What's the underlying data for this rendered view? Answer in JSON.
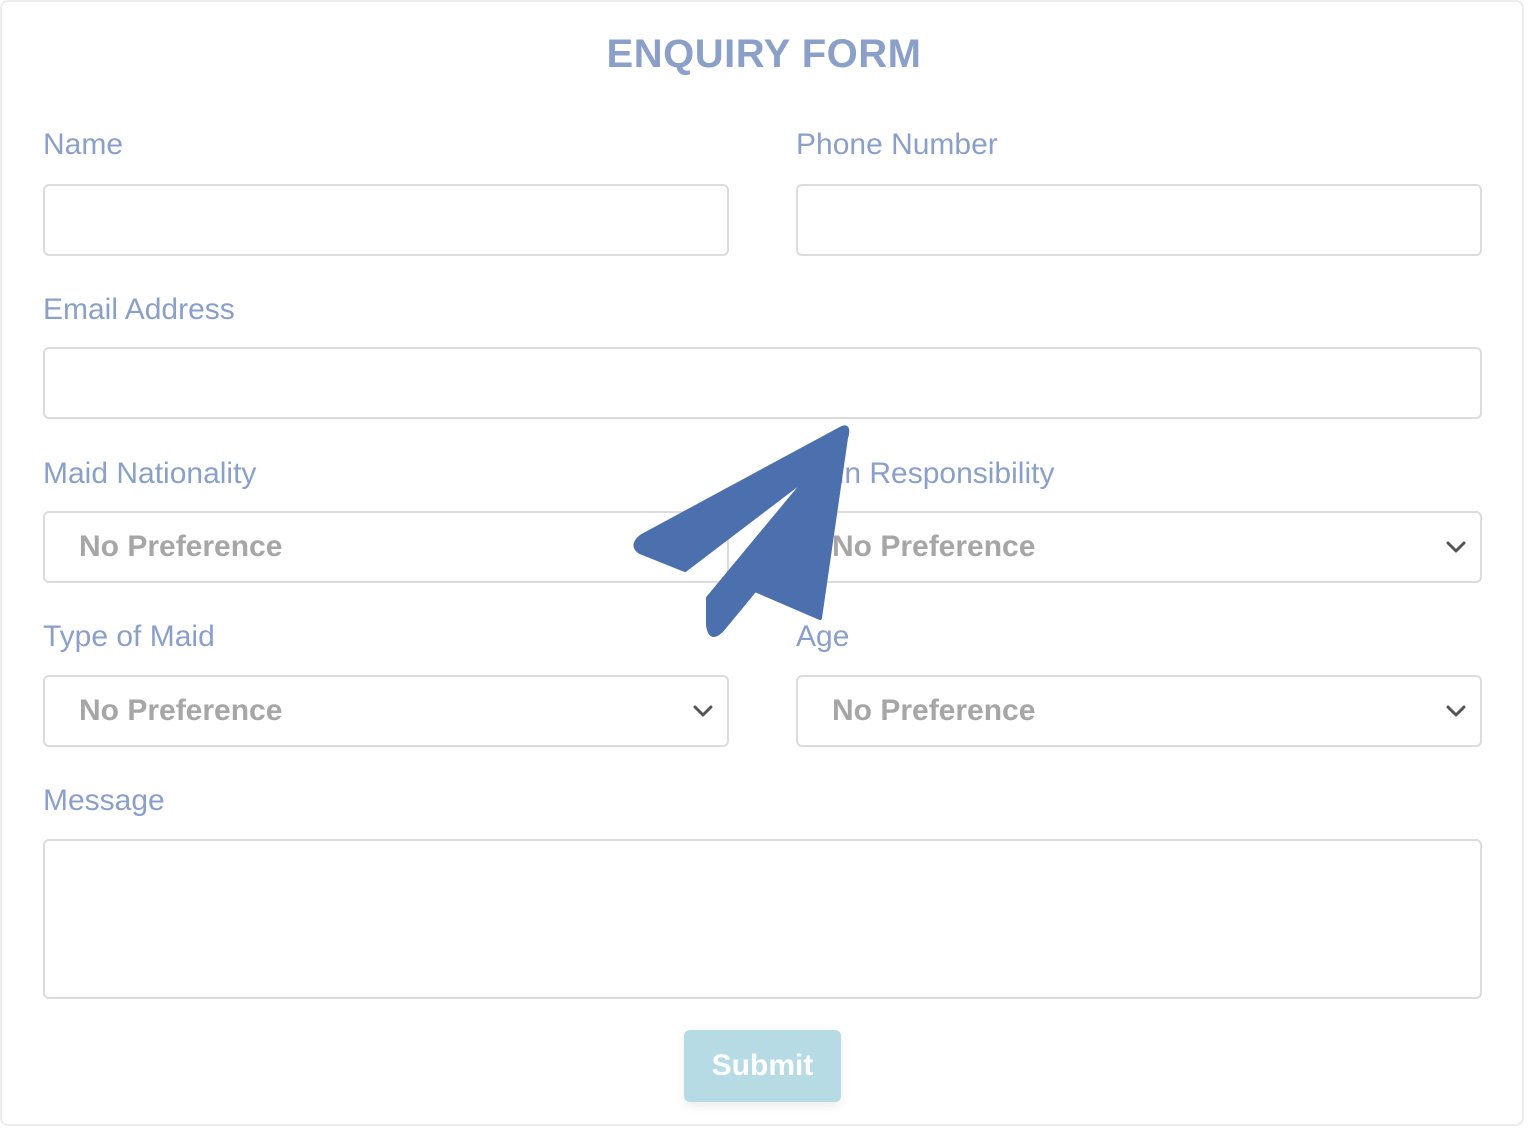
{
  "form": {
    "title": "ENQUIRY FORM",
    "name_label": "Name",
    "name_value": "",
    "phone_label": "Phone Number",
    "phone_value": "",
    "email_label": "Email Address",
    "email_value": "",
    "nationality_label": "Maid Nationality",
    "nationality_value": "No Preference",
    "responsibility_label": "Main Responsibility",
    "responsibility_value": "No Preference",
    "type_label": "Type of Maid",
    "type_value": "No Preference",
    "age_label": "Age",
    "age_value": "No Preference",
    "message_label": "Message",
    "message_value": "",
    "submit_label": "Submit"
  },
  "colors": {
    "label": "#8aa0c8",
    "overlay_icon": "#4c70ad",
    "submit_bg": "#b6dbe5"
  },
  "icons": {
    "overlay": "paper-plane-icon",
    "select_arrow": "chevron-down-icon",
    "textarea_grip": "resize-grip-icon"
  }
}
